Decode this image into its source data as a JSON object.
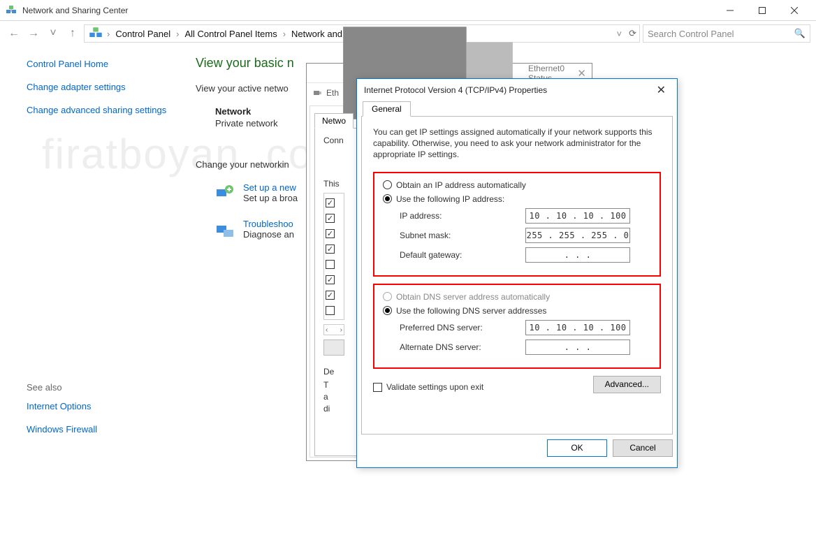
{
  "window": {
    "title": "Network and Sharing Center"
  },
  "breadcrumb": {
    "items": [
      "Control Panel",
      "All Control Panel Items",
      "Network and Sharing Center"
    ]
  },
  "search": {
    "placeholder": "Search Control Panel"
  },
  "sidebar": {
    "home": "Control Panel Home",
    "links": [
      "Change adapter settings",
      "Change advanced sharing settings"
    ],
    "see_also_label": "See also",
    "see_also": [
      "Internet Options",
      "Windows Firewall"
    ]
  },
  "main": {
    "heading": "View your basic n",
    "active_line": "View your active netwo",
    "network_label": "Network",
    "network_type": "Private network",
    "change_heading": "Change your networkin",
    "action1_title": "Set up a new",
    "action1_desc": "Set up a broa",
    "action2_title": "Troubleshoo",
    "action2_desc": "Diagnose an"
  },
  "mid_dialog": {
    "title": "Ethernet0 Status",
    "row2": "Eth",
    "tab": "Netwo",
    "conn_label": "Conn",
    "this_label": "This",
    "checks": [
      true,
      true,
      true,
      true,
      false,
      true,
      true,
      false
    ],
    "desc_label": "De",
    "desc_lines": [
      "T",
      "a",
      "di"
    ]
  },
  "front_dialog": {
    "title": "Internet Protocol Version 4 (TCP/IPv4) Properties",
    "tab": "General",
    "intro": "You can get IP settings assigned automatically if your network supports this capability. Otherwise, you need to ask your network administrator for the appropriate IP settings.",
    "ip_auto_label": "Obtain an IP address automatically",
    "ip_manual_label": "Use the following IP address:",
    "ip_selected": "manual",
    "ip_label": "IP address:",
    "ip_value": "10 . 10 . 10 . 100",
    "subnet_label": "Subnet mask:",
    "subnet_value": "255 . 255 . 255 .  0",
    "gateway_label": "Default gateway:",
    "gateway_value": ".      .      .",
    "dns_auto_label": "Obtain DNS server address automatically",
    "dns_manual_label": "Use the following DNS server addresses",
    "dns_selected": "manual",
    "pref_dns_label": "Preferred DNS server:",
    "pref_dns_value": "10 . 10 . 10 . 100",
    "alt_dns_label": "Alternate DNS server:",
    "alt_dns_value": ".      .      .",
    "validate_label": "Validate settings upon exit",
    "validate_checked": false,
    "advanced_label": "Advanced...",
    "ok_label": "OK",
    "cancel_label": "Cancel"
  },
  "watermark": "firatboyan .com"
}
